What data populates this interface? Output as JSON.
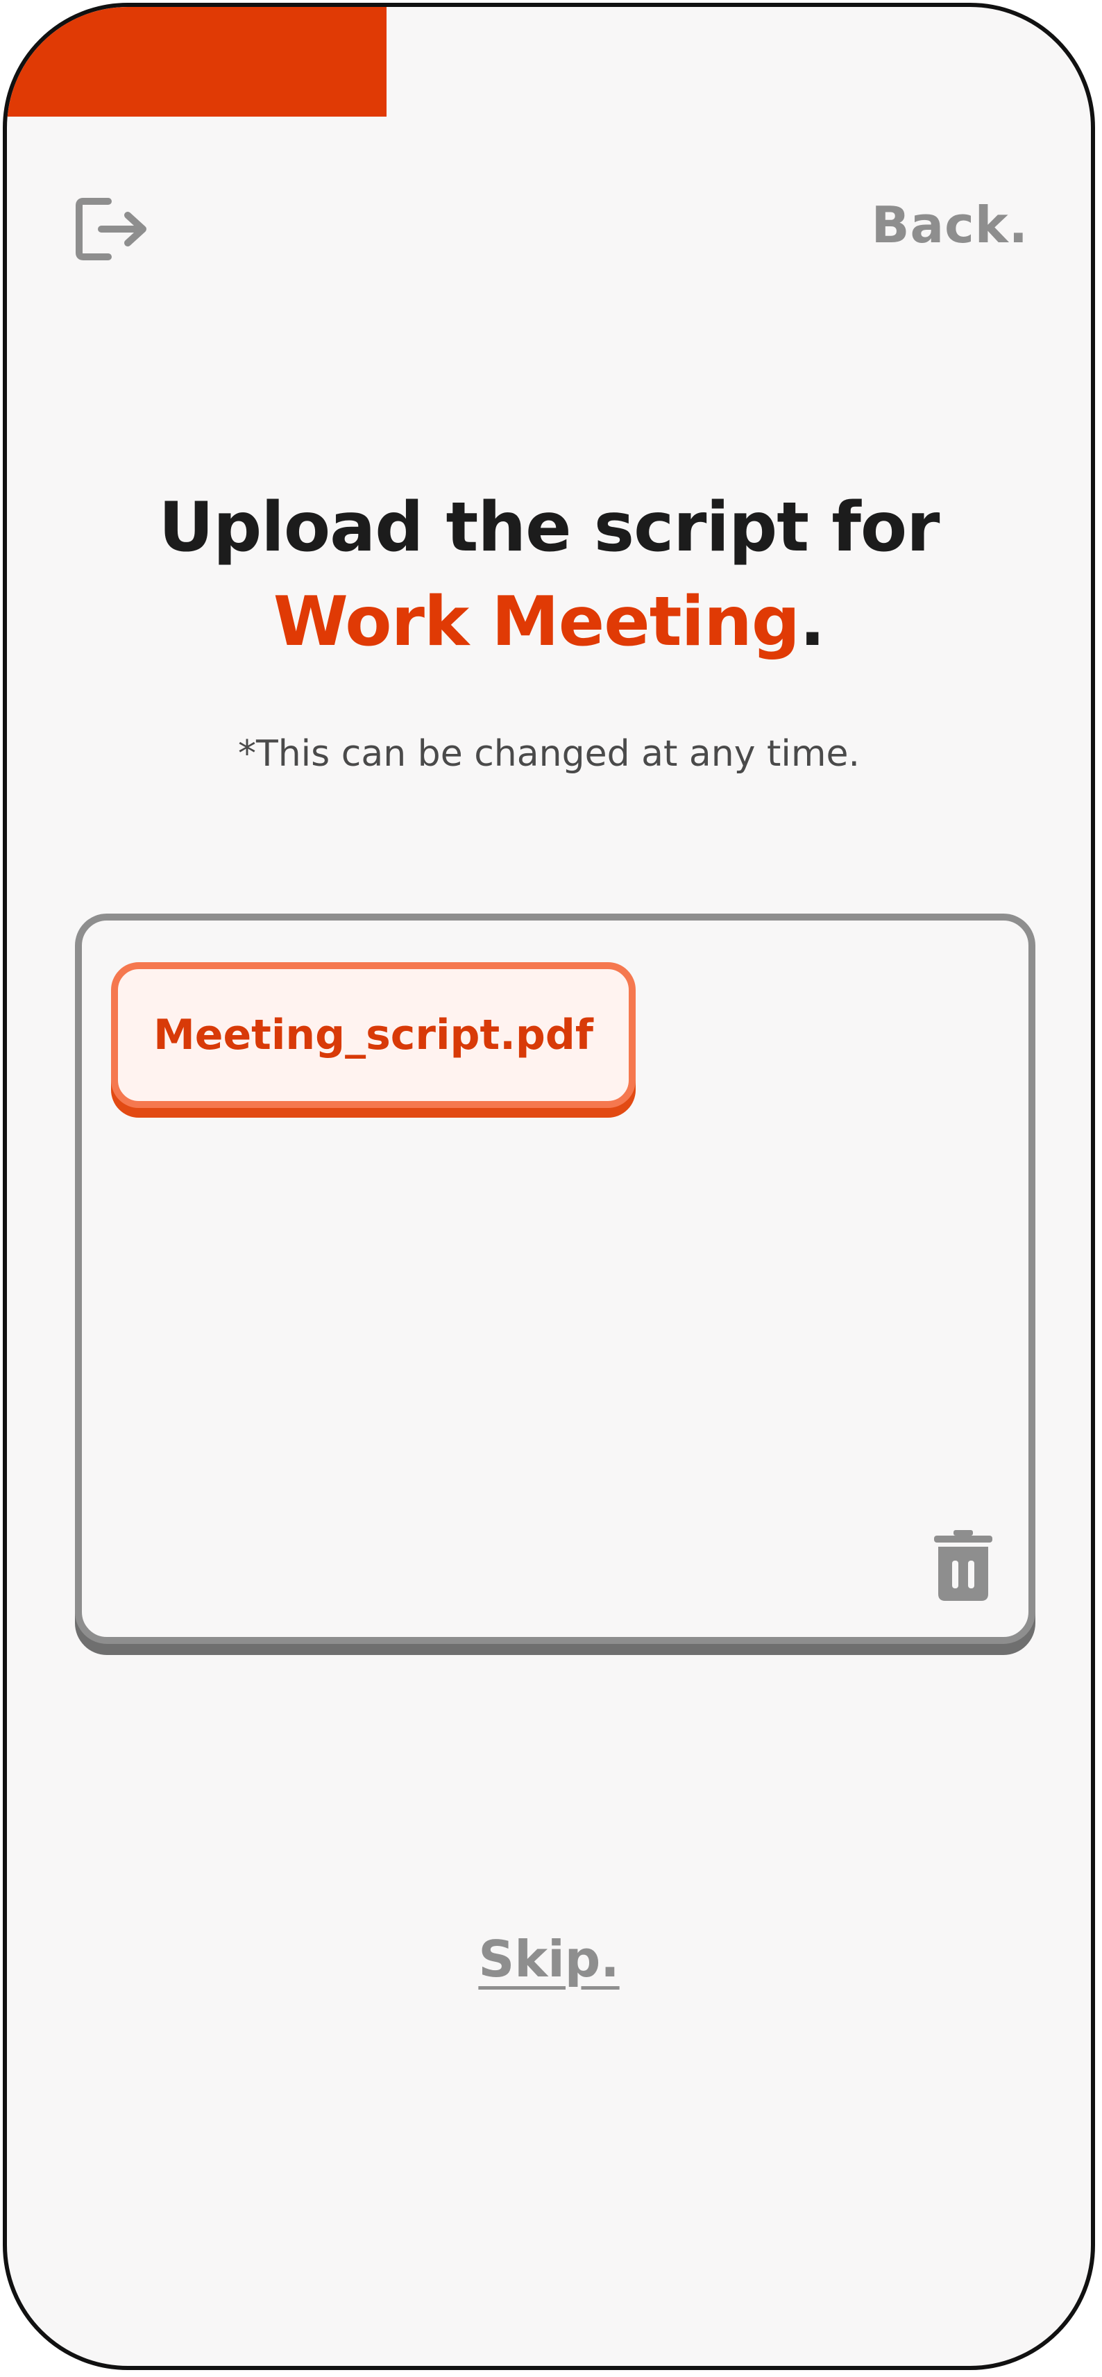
{
  "progress": {
    "fraction": 0.35,
    "color": "#e03a05"
  },
  "header": {
    "logout_icon": "logout-icon",
    "back_label": "Back."
  },
  "main": {
    "title_line1": "Upload the script for",
    "title_highlight": "Work Meeting",
    "title_period": ".",
    "note": "*This can be changed at any time."
  },
  "upload": {
    "file_name": "Meeting_script.pdf",
    "delete_icon": "trash-icon"
  },
  "footer": {
    "skip_label": "Skip."
  },
  "colors": {
    "accent": "#e03a05",
    "text": "#1c1c1c",
    "muted": "#8e8e8e",
    "background": "#f8f7f7"
  }
}
